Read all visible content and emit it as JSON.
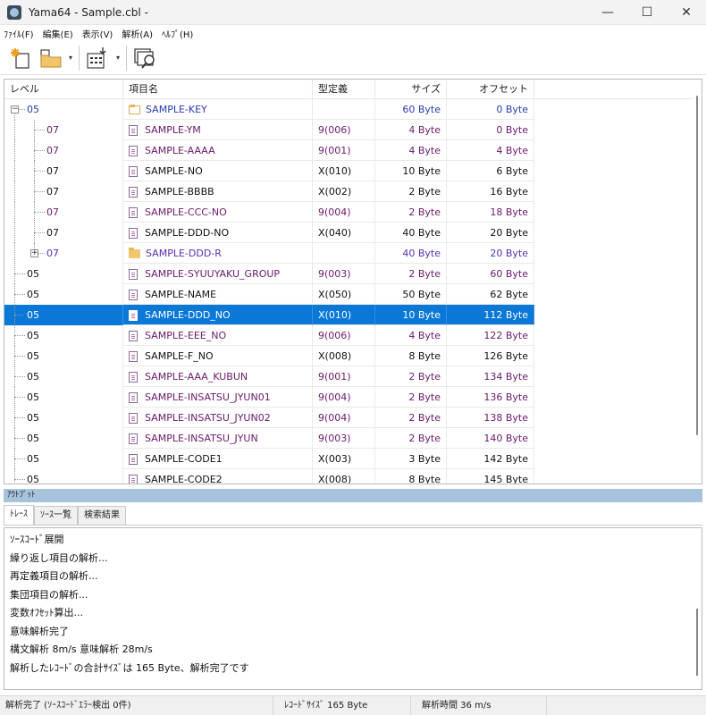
{
  "window": {
    "title": "Yama64 - Sample.cbl -",
    "minimize_glyph": "—",
    "maximize_glyph": "☐",
    "close_glyph": "✕"
  },
  "menu": [
    {
      "label": "ﾌｧｲﾙ(F)"
    },
    {
      "label": "編集(E)"
    },
    {
      "label": "表示(V)"
    },
    {
      "label": "解析(A)"
    },
    {
      "label": "ﾍﾙﾌﾟ(H)"
    }
  ],
  "toolbar": {
    "icons": [
      "new-file-icon",
      "open-folder-icon",
      "export-icon",
      "search-window-icon"
    ],
    "dropdown_glyph": "▾"
  },
  "grid": {
    "headers": {
      "level": "レベル",
      "name": "項目名",
      "type": "型定義",
      "size": "サイズ",
      "offset": "オフセット"
    },
    "rows": [
      {
        "level": "05",
        "name": "SAMPLE-KEY",
        "type": "",
        "size": "60 Byte",
        "offset": "0 Byte",
        "kind": "folder-open",
        "depth": 0,
        "expander": "−",
        "color": "#2a3cb0"
      },
      {
        "level": "07",
        "name": "SAMPLE-YM",
        "type": "9(006)",
        "size": "4 Byte",
        "offset": "0 Byte",
        "kind": "doc",
        "depth": 1,
        "color": "#6b1a6b"
      },
      {
        "level": "07",
        "name": "SAMPLE-AAAA",
        "type": "9(001)",
        "size": "4 Byte",
        "offset": "4 Byte",
        "kind": "doc",
        "depth": 1,
        "color": "#6b1a6b"
      },
      {
        "level": "07",
        "name": "SAMPLE-NO",
        "type": "X(010)",
        "size": "10 Byte",
        "offset": "6 Byte",
        "kind": "doc",
        "depth": 1,
        "color": "#111111"
      },
      {
        "level": "07",
        "name": "SAMPLE-BBBB",
        "type": "X(002)",
        "size": "2 Byte",
        "offset": "16 Byte",
        "kind": "doc",
        "depth": 1,
        "color": "#111111"
      },
      {
        "level": "07",
        "name": "SAMPLE-CCC-NO",
        "type": "9(004)",
        "size": "2 Byte",
        "offset": "18 Byte",
        "kind": "doc",
        "depth": 1,
        "color": "#6b1a6b"
      },
      {
        "level": "07",
        "name": "SAMPLE-DDD-NO",
        "type": "X(040)",
        "size": "40 Byte",
        "offset": "20 Byte",
        "kind": "doc",
        "depth": 1,
        "color": "#111111"
      },
      {
        "level": "07",
        "name": "SAMPLE-DDD-R",
        "type": "",
        "size": "40 Byte",
        "offset": "20 Byte",
        "kind": "folder",
        "depth": 1,
        "expander": "+",
        "color": "#5a2fb0"
      },
      {
        "level": "05",
        "name": "SAMPLE-SYUUYAKU_GROUP",
        "type": "9(003)",
        "size": "2 Byte",
        "offset": "60 Byte",
        "kind": "doc",
        "depth": 0,
        "color": "#6b1a6b"
      },
      {
        "level": "05",
        "name": "SAMPLE-NAME",
        "type": "X(050)",
        "size": "50 Byte",
        "offset": "62 Byte",
        "kind": "doc",
        "depth": 0,
        "color": "#111111"
      },
      {
        "level": "05",
        "name": "SAMPLE-DDD_NO",
        "type": "X(010)",
        "size": "10 Byte",
        "offset": "112 Byte",
        "kind": "doc",
        "depth": 0,
        "color": "#111111",
        "selected": true
      },
      {
        "level": "05",
        "name": "SAMPLE-EEE_NO",
        "type": "9(006)",
        "size": "4 Byte",
        "offset": "122 Byte",
        "kind": "doc",
        "depth": 0,
        "color": "#6b1a6b"
      },
      {
        "level": "05",
        "name": "SAMPLE-F_NO",
        "type": "X(008)",
        "size": "8 Byte",
        "offset": "126 Byte",
        "kind": "doc",
        "depth": 0,
        "color": "#111111"
      },
      {
        "level": "05",
        "name": "SAMPLE-AAA_KUBUN",
        "type": "9(001)",
        "size": "2 Byte",
        "offset": "134 Byte",
        "kind": "doc",
        "depth": 0,
        "color": "#6b1a6b"
      },
      {
        "level": "05",
        "name": "SAMPLE-INSATSU_JYUN01",
        "type": "9(004)",
        "size": "2 Byte",
        "offset": "136 Byte",
        "kind": "doc",
        "depth": 0,
        "color": "#6b1a6b"
      },
      {
        "level": "05",
        "name": "SAMPLE-INSATSU_JYUN02",
        "type": "9(004)",
        "size": "2 Byte",
        "offset": "138 Byte",
        "kind": "doc",
        "depth": 0,
        "color": "#6b1a6b"
      },
      {
        "level": "05",
        "name": "SAMPLE-INSATSU_JYUN",
        "type": "9(003)",
        "size": "2 Byte",
        "offset": "140 Byte",
        "kind": "doc",
        "depth": 0,
        "color": "#6b1a6b"
      },
      {
        "level": "05",
        "name": "SAMPLE-CODE1",
        "type": "X(003)",
        "size": "3 Byte",
        "offset": "142 Byte",
        "kind": "doc",
        "depth": 0,
        "color": "#111111"
      },
      {
        "level": "05",
        "name": "SAMPLE-CODE2",
        "type": "X(008)",
        "size": "8 Byte",
        "offset": "145 Byte",
        "kind": "doc",
        "depth": 0,
        "color": "#111111"
      }
    ]
  },
  "output": {
    "header": "ｱｳﾄﾌﾟｯﾄ",
    "tabs": [
      {
        "label": "ﾄﾚｰｽ",
        "active": true
      },
      {
        "label": "ｿｰｽ一覧",
        "active": false
      },
      {
        "label": "検索結果",
        "active": false
      }
    ],
    "lines": [
      "ｿｰｽｺｰﾄﾞ展開",
      "繰り返し項目の解析...",
      "再定義項目の解析...",
      "集団項目の解析...",
      "変数ｵﾌｾｯﾄ算出...",
      "意味解析完了",
      "構文解析 8m/s 意味解析 28m/s",
      "解析したﾚｺｰﾄﾞの合計ｻｲｽﾞは 165 Byte、解析完了です"
    ]
  },
  "status": {
    "left": "解析完了 (ｿｰｽｺｰﾄﾞｴﾗｰ検出 0件)",
    "record_size": "ﾚｺｰﾄﾞｻｲｽﾞ 165 Byte",
    "time": "解析時間 36 m/s"
  }
}
